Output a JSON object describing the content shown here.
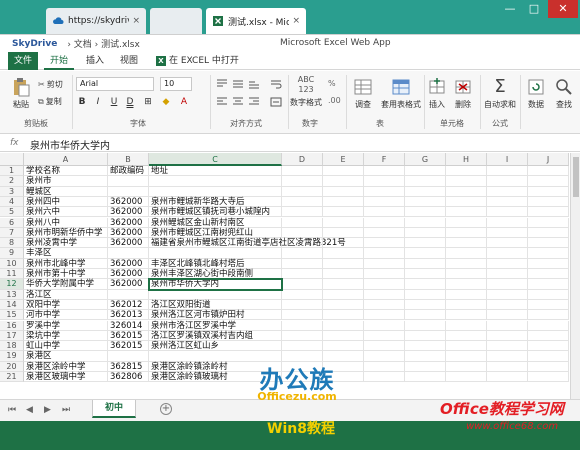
{
  "browser": {
    "tabs": [
      {
        "label": "https://skydrive.liv...",
        "close": "×"
      },
      {
        "label": "测试.xlsx - Microsoft Exc...",
        "close": "×"
      }
    ],
    "window_controls": {
      "minimize": "—",
      "maximize": "□",
      "close": "✕"
    }
  },
  "app_bar": {
    "brand": "SkyDrive",
    "breadcrumb": "› 文档 › 测试.xlsx",
    "title": "Microsoft Excel Web App"
  },
  "ribbon_tabs": {
    "file": "文件",
    "home": "开始",
    "insert": "插入",
    "view": "视图",
    "open_in_excel": "在 EXCEL 中打开",
    "selected": "开始"
  },
  "ribbon": {
    "clipboard": {
      "paste": "粘贴",
      "cut": "剪切",
      "copy": "复制",
      "label": "剪贴板"
    },
    "font": {
      "name": "Arial",
      "size": "10",
      "bold": "B",
      "italic": "I",
      "underline": "U",
      "double_underline": "D",
      "label": "字体"
    },
    "alignment": {
      "label": "对齐方式"
    },
    "number": {
      "format_label": "数字格式",
      "icon_text": "ABC 123",
      "label": "数字"
    },
    "table": {
      "adjust": "调查",
      "format_as_table": "套用表格式",
      "label": "表"
    },
    "cells": {
      "insert": "插入",
      "delete": "删除",
      "label": "单元格"
    },
    "formulas": {
      "autosum": "自动求和",
      "label": "公式"
    },
    "data": {
      "data": "数据",
      "find": "查找"
    }
  },
  "formula_bar": {
    "fx": "fx",
    "value": "泉州市华侨大学内"
  },
  "grid": {
    "columns": [
      "A",
      "B",
      "C",
      "D",
      "E",
      "F",
      "G",
      "H",
      "I",
      "J"
    ],
    "selected_column": "C",
    "selected_row": "12",
    "rows": [
      {
        "n": "1",
        "a": "学校名称",
        "b": "邮政编码",
        "c": "地址"
      },
      {
        "n": "2",
        "a": "泉州市",
        "b": "",
        "c": ""
      },
      {
        "n": "3",
        "a": "鲤城区",
        "b": "",
        "c": ""
      },
      {
        "n": "4",
        "a": "泉州四中",
        "b": "362000",
        "c": "泉州市鲤城新华路大寺后"
      },
      {
        "n": "5",
        "a": "泉州六中",
        "b": "362000",
        "c": "泉州市鲤城区镇抚司巷小城隍内"
      },
      {
        "n": "6",
        "a": "泉州八中",
        "b": "362000",
        "c": "泉州鲤城区金山新村南区"
      },
      {
        "n": "7",
        "a": "泉州市明新华侨中学",
        "b": "362000",
        "c": "泉州市鲤城区江南树兜红山"
      },
      {
        "n": "8",
        "a": "泉州凌霄中学",
        "b": "362000",
        "c": "福建省泉州市鲤城区江南街道亭店社区凌霄路321号"
      },
      {
        "n": "9",
        "a": "丰泽区",
        "b": "",
        "c": ""
      },
      {
        "n": "10",
        "a": "泉州市北峰中学",
        "b": "362000",
        "c": "丰泽区北峰镇北峰村塔后"
      },
      {
        "n": "11",
        "a": "泉州市第十中学",
        "b": "362000",
        "c": "泉州丰泽区湖心街中段南侧"
      },
      {
        "n": "12",
        "a": "华侨大学附属中学",
        "b": "362000",
        "c": "泉州市华侨大学内"
      },
      {
        "n": "13",
        "a": "洛江区",
        "b": "",
        "c": ""
      },
      {
        "n": "14",
        "a": "双阳中学",
        "b": "362012",
        "c": "洛江区双阳街道"
      },
      {
        "n": "15",
        "a": "河市中学",
        "b": "362013",
        "c": "泉州洛江区河市镇炉田村"
      },
      {
        "n": "16",
        "a": "罗溪中学",
        "b": "326014",
        "c": "泉州市洛江区罗溪中学"
      },
      {
        "n": "17",
        "a": "梁坑中学",
        "b": "362015",
        "c": "洛江区罗溪镇双溪村吉内组"
      },
      {
        "n": "18",
        "a": "虹山中学",
        "b": "362015",
        "c": "泉州洛江区虹山乡"
      },
      {
        "n": "19",
        "a": "泉港区",
        "b": "",
        "c": ""
      },
      {
        "n": "20",
        "a": "泉港区涂岭中学",
        "b": "362815",
        "c": "泉港区涂岭镇涂岭村"
      },
      {
        "n": "21",
        "a": "泉港区玻璃中学",
        "b": "362806",
        "c": "泉港区涂岭镇玻璃村"
      }
    ]
  },
  "sheets": {
    "active": "初中",
    "add": "+"
  },
  "watermarks": {
    "logo_title": "办公族",
    "logo_url": "Officezu.com",
    "win8": "Win8教程",
    "site_title": "Office教程学习网",
    "site_url": "www.office68.com"
  }
}
